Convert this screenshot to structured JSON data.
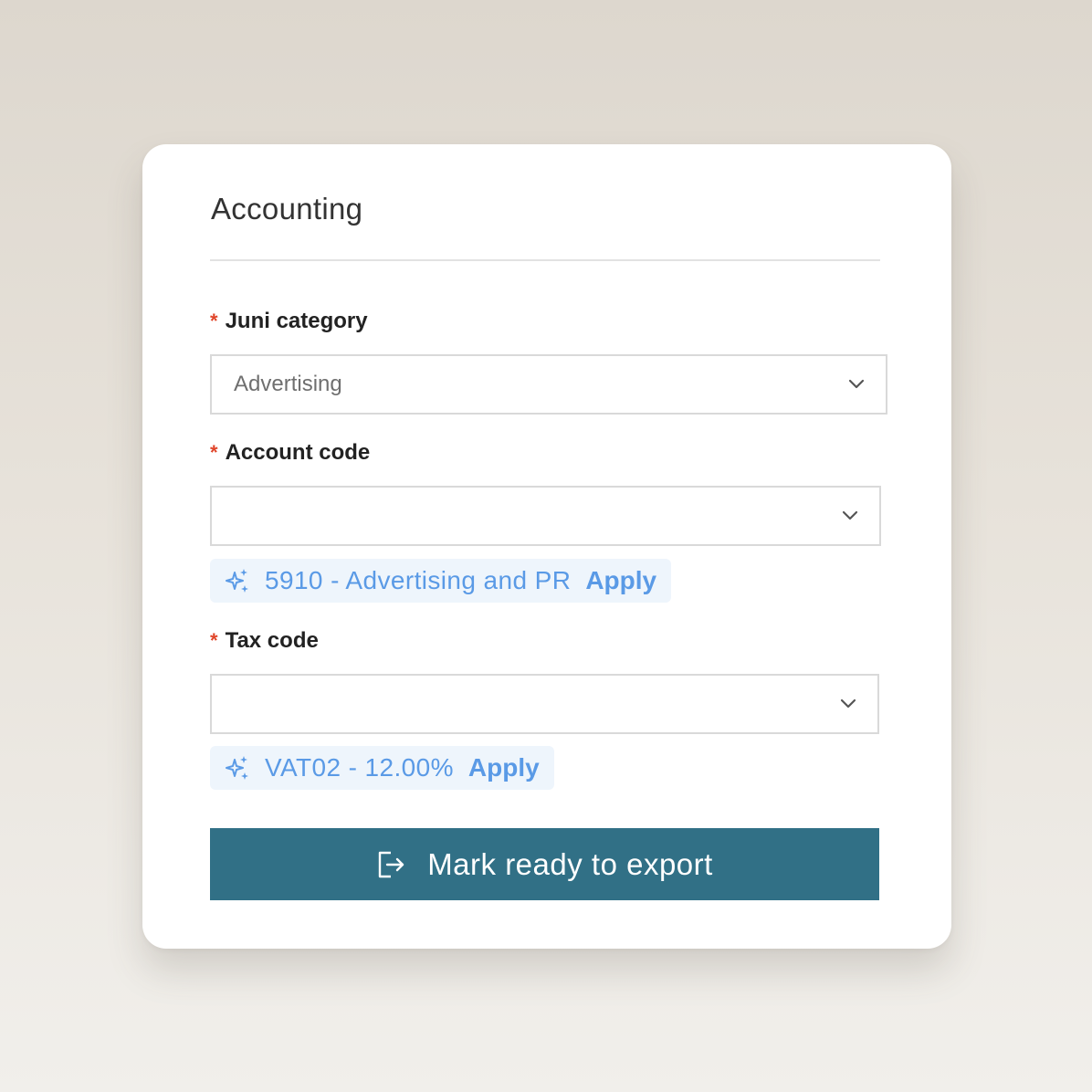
{
  "panel": {
    "title": "Accounting"
  },
  "fields": {
    "juni_category": {
      "required_mark": "*",
      "label": "Juni category",
      "value": "Advertising",
      "icon": "chevron-down-icon"
    },
    "account_code": {
      "required_mark": "*",
      "label": "Account code",
      "value": "",
      "icon": "chevron-down-icon",
      "suggestion": {
        "icon": "sparkle-icon",
        "text": "5910 - Advertising and PR",
        "action": "Apply"
      }
    },
    "tax_code": {
      "required_mark": "*",
      "label": "Tax code",
      "value": "",
      "icon": "chevron-down-icon",
      "suggestion": {
        "icon": "sparkle-icon",
        "text": "VAT02 - 12.00%",
        "action": "Apply"
      }
    }
  },
  "actions": {
    "export_label": "Mark ready to export",
    "export_icon": "export-icon"
  },
  "colors": {
    "accent": "#317086",
    "suggestion_text": "#5a9ae6",
    "suggestion_bg": "#eef5fc",
    "required": "#e0452a"
  }
}
